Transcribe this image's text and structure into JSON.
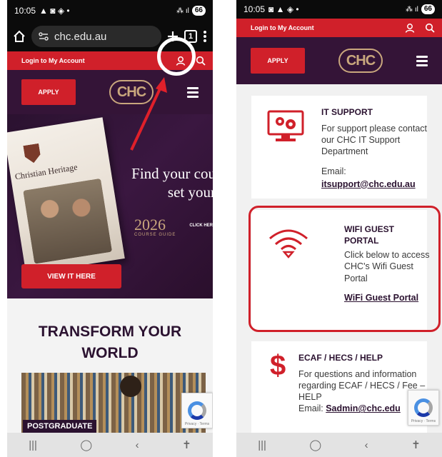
{
  "status": {
    "time": "10:05",
    "battery": "66"
  },
  "browser": {
    "url": "chc.edu.au",
    "tab_count": "1"
  },
  "site": {
    "login_label": "Login to My Account",
    "apply_label": "APPLY",
    "logo_text": "CHC"
  },
  "hero": {
    "guide_title": "Christian Heritage",
    "headline_line1": "Find your cou",
    "headline_line2": "set your",
    "year": "2026",
    "guide_label": "COURSE GUIDE",
    "click_label": "CLICK HER",
    "view_button": "VIEW IT HERE"
  },
  "transform": {
    "line1": "TRANSFORM YOUR",
    "line2": "WORLD",
    "postgrad_label": "POSTGRADUATE"
  },
  "recaptcha": {
    "text": "Privacy · Terms"
  },
  "cards": {
    "it": {
      "title": "IT SUPPORT",
      "body": "For support please contact our CHC IT Support Department",
      "email_label": "Email:",
      "email": "itsupport@chc.edu.au"
    },
    "wifi": {
      "title": "WIFI GUEST PORTAL",
      "body": "Click below to access CHC's Wifi Guest Portal",
      "link": "WiFi Guest Portal"
    },
    "ecaf": {
      "title": "ECAF / HECS / HELP",
      "body": "For questions and information regarding ECAF / HECS / Fee – HELP",
      "email_label": "Email:",
      "email": "Sadmin@chc.edu",
      "icon_char": "$"
    }
  },
  "colors": {
    "brand_red": "#d0202a",
    "brand_purple": "#341437",
    "logo_gold": "#c9a77d"
  }
}
